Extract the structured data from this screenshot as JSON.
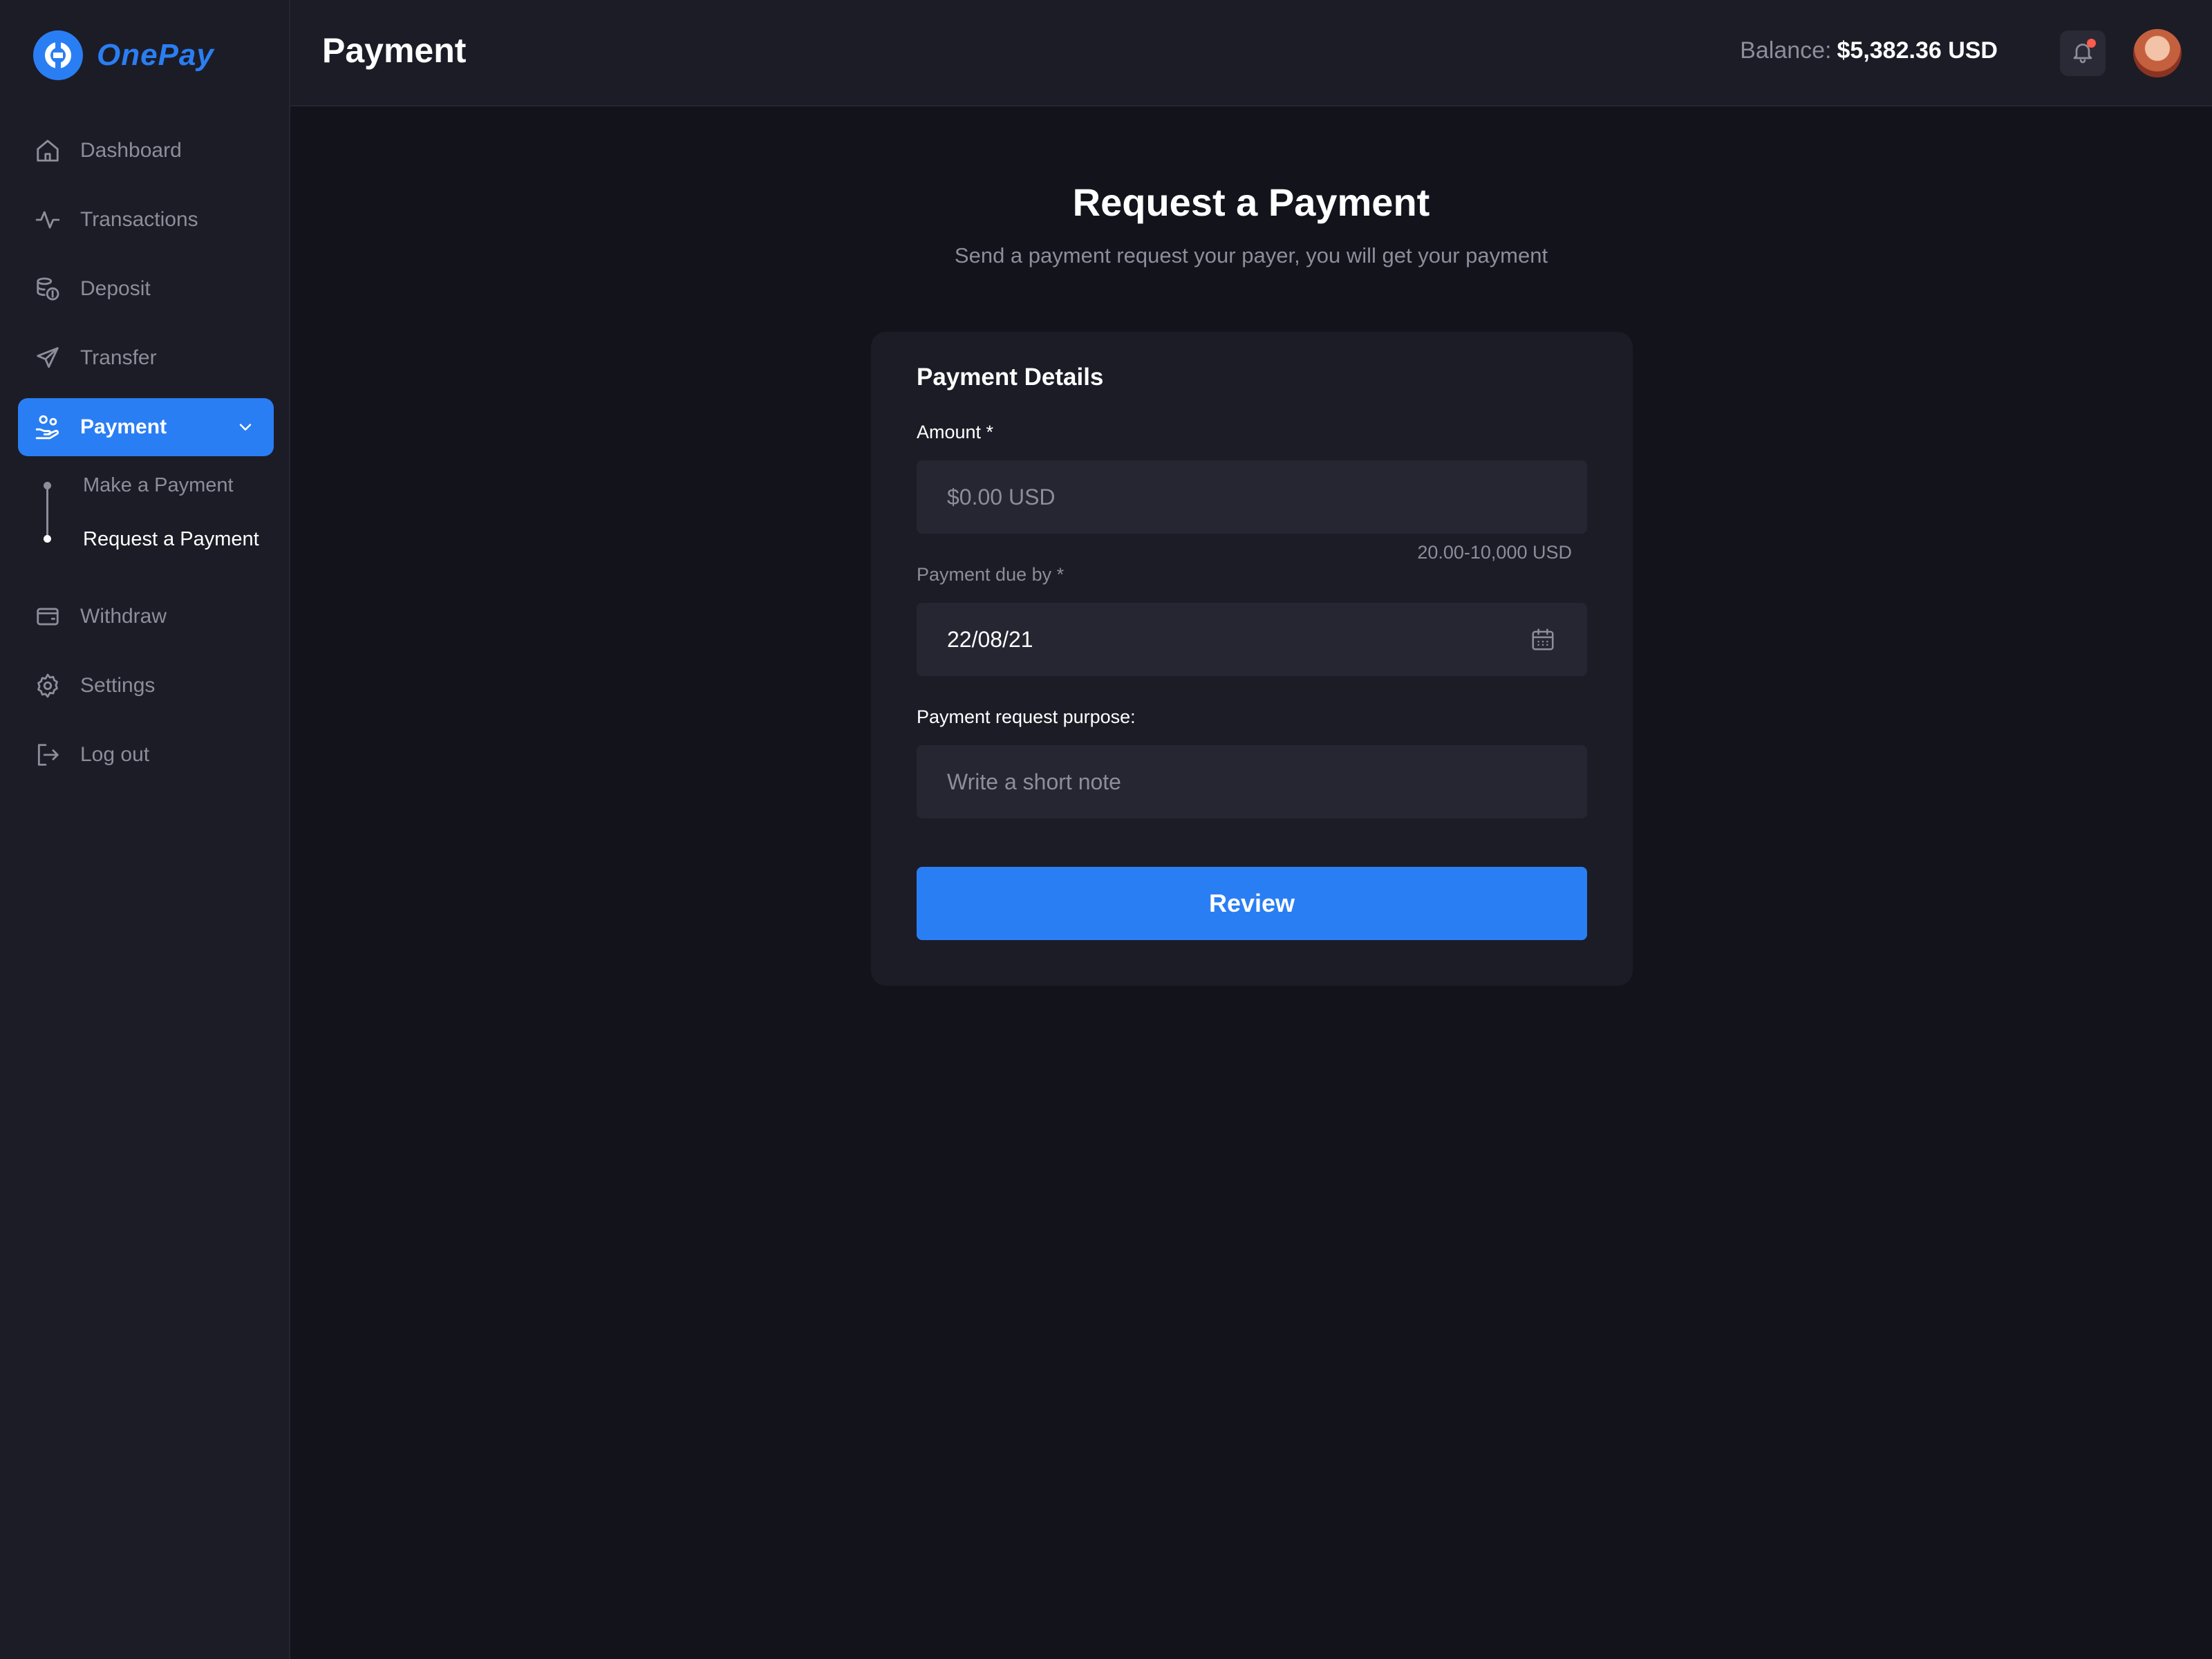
{
  "app": {
    "name": "OnePay",
    "accent_color": "#2a7ef3",
    "background_color": "#13131c",
    "surface_color": "#1c1c26"
  },
  "sidebar": {
    "items": [
      {
        "label": "Dashboard",
        "icon": "home-icon"
      },
      {
        "label": "Transactions",
        "icon": "activity-icon"
      },
      {
        "label": "Deposit",
        "icon": "coins-icon"
      },
      {
        "label": "Transfer",
        "icon": "send-icon"
      },
      {
        "label": "Payment",
        "icon": "hand-coins-icon",
        "active": true,
        "expanded": true,
        "children": [
          {
            "label": "Make a Payment"
          },
          {
            "label": "Request a Payment",
            "active": true
          }
        ]
      },
      {
        "label": "Withdraw",
        "icon": "wallet-icon"
      },
      {
        "label": "Settings",
        "icon": "gear-icon"
      },
      {
        "label": "Log out",
        "icon": "logout-icon"
      }
    ]
  },
  "header": {
    "title": "Payment",
    "balance_label": "Balance:",
    "balance_value": "$5,382.36 USD",
    "notification_indicator_color": "#ff5b4a"
  },
  "main": {
    "title": "Request a Payment",
    "subtitle": "Send a payment request your payer, you will get your payment",
    "card": {
      "title": "Payment Details",
      "amount": {
        "label": "Amount *",
        "placeholder": "$0.00 USD",
        "hint": "20.00-10,000 USD"
      },
      "due_date": {
        "label": "Payment due by *",
        "value": "22/08/21"
      },
      "purpose": {
        "label": "Payment request purpose:",
        "placeholder": "Write a short note"
      },
      "submit_label": "Review"
    }
  }
}
